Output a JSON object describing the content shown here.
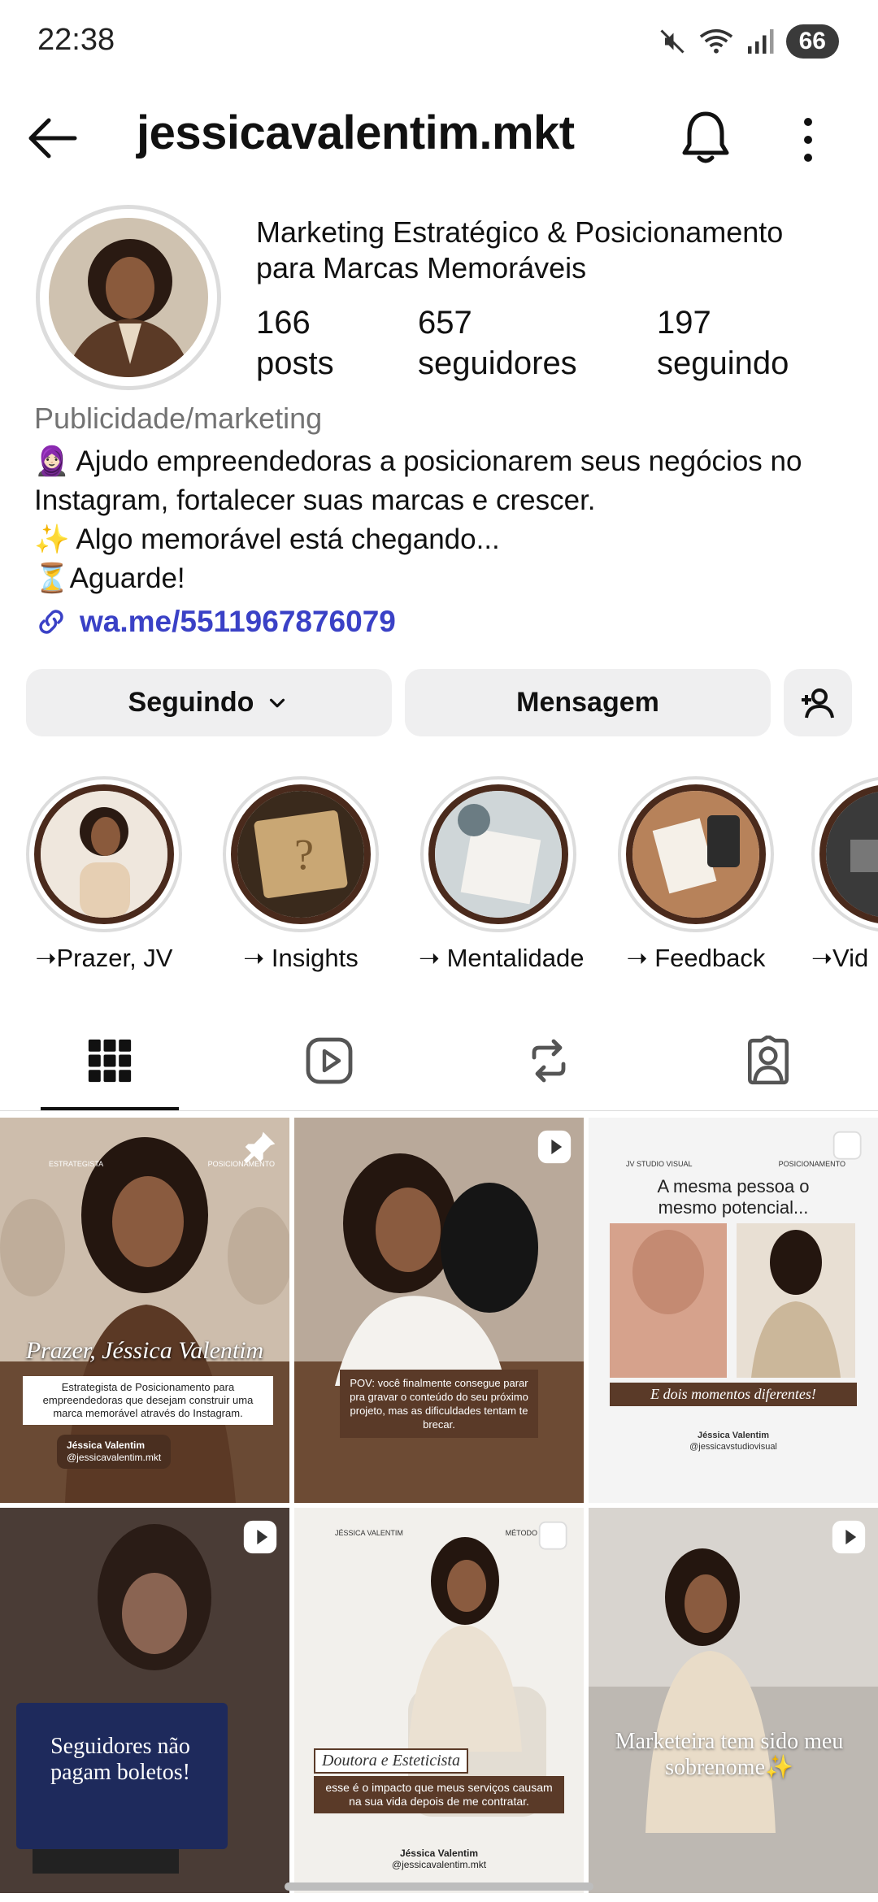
{
  "status_bar": {
    "time": "22:38",
    "battery": "66"
  },
  "header": {
    "username": "jessicavalentim.mkt"
  },
  "profile": {
    "bio_title_line1": "Marketing Estratégico & Posicionamento",
    "bio_title_line2": "para Marcas Memoráveis",
    "stats": [
      {
        "value": "166",
        "label": "posts"
      },
      {
        "value": "657",
        "label": "seguidores"
      },
      {
        "value": "197",
        "label": "seguindo"
      }
    ],
    "category": "Publicidade/marketing",
    "bio_lines": [
      "🧕🏻 Ajudo empreendedoras a posicionarem seus negócios no",
      "Instagram, fortalecer suas marcas e crescer.",
      "✨ Algo memorável está chegando...",
      "⏳Aguarde!"
    ],
    "link": "wa.me/5511967876079"
  },
  "buttons": {
    "following": "Seguindo",
    "message": "Mensagem"
  },
  "highlights": [
    {
      "label": "➝Prazer, JV"
    },
    {
      "label": "➝ Insights"
    },
    {
      "label": "➝ Mentalidade"
    },
    {
      "label": "➝ Feedback"
    },
    {
      "label": "➝Vid"
    }
  ],
  "posts": [
    {
      "header_left": "ESTRATEGISTA",
      "header_right": "POSICIONAMENTO",
      "title": "Prazer, Jéssica Valentim",
      "caption": "Estrategista de Posicionamento para empreendedoras que desejam construir uma marca memorável através do Instagram.",
      "author": "Jéssica Valentim",
      "handle": "@jessicavalentim.mkt"
    },
    {
      "caption": "POV: você finalmente consegue parar pra gravar o conteúdo do seu próximo projeto, mas as dificuldades tentam te brecar."
    },
    {
      "header_left": "JV STUDIO VISUAL",
      "header_right": "POSICIONAMENTO",
      "title": "A mesma pessoa o mesmo potencial...",
      "subtitle": "E dois momentos diferentes!",
      "author": "Jéssica Valentim",
      "handle": "@jessicavstudiovisual"
    },
    {
      "title": "Seguidores não pagam boletos!"
    },
    {
      "header_left": "JÉSSICA VALENTIM",
      "header_right": "MÉTODO EPI",
      "title": "Doutora e Esteticista",
      "caption": "esse é o impacto que meus serviços causam na sua vida depois de me contratar.",
      "author": "Jéssica Valentim",
      "handle": "@jessicavalentim.mkt"
    },
    {
      "title": "Marketeira tem sido meu sobrenome✨"
    }
  ],
  "colors": {
    "link": "#3a41c6",
    "button_bg": "#efeff0",
    "highlight_border": "#4a2a1c"
  }
}
